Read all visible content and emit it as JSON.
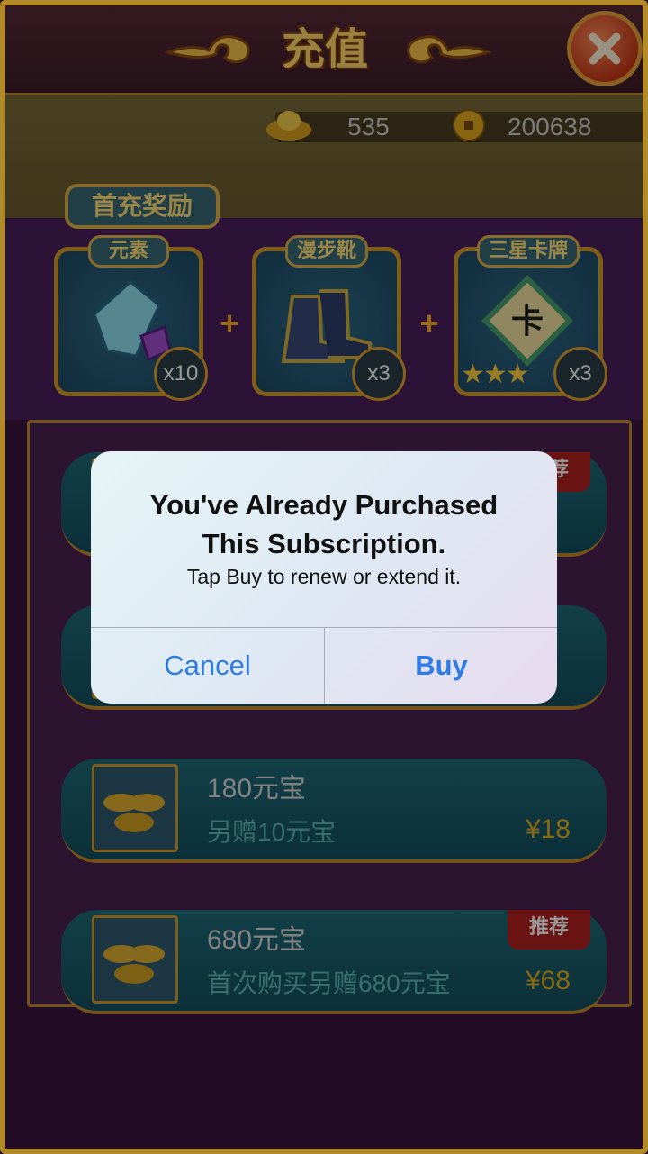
{
  "header": {
    "title": "充值"
  },
  "currency": {
    "ingots": "535",
    "coins": "200638"
  },
  "first_reward": {
    "title": "首充奖励",
    "items": [
      {
        "label": "元素",
        "qty": "x10",
        "icon": "crystal-icon"
      },
      {
        "label": "漫步靴",
        "qty": "x3",
        "icon": "boots-icon"
      },
      {
        "label": "三星卡牌",
        "qty": "x3",
        "icon": "card-icon",
        "stars": "★★★"
      }
    ]
  },
  "packs": [
    {
      "name": "",
      "sub": "",
      "price": "",
      "tag": "推荐"
    },
    {
      "name": "",
      "sub": "",
      "price": "",
      "tag": ""
    },
    {
      "name": "180元宝",
      "sub": "另赠10元宝",
      "price": "¥18",
      "tag": ""
    },
    {
      "name": "680元宝",
      "sub": "首次购买另赠680元宝",
      "price": "¥68",
      "tag": "推荐"
    }
  ],
  "alert": {
    "title": "You've Already Purchased This Subscription.",
    "message": "Tap Buy to renew or extend it.",
    "cancel_label": "Cancel",
    "buy_label": "Buy"
  },
  "colors": {
    "ios_blue": "#2f7ce6",
    "gold": "#e0b020",
    "panel_purple": "#4a2050"
  }
}
